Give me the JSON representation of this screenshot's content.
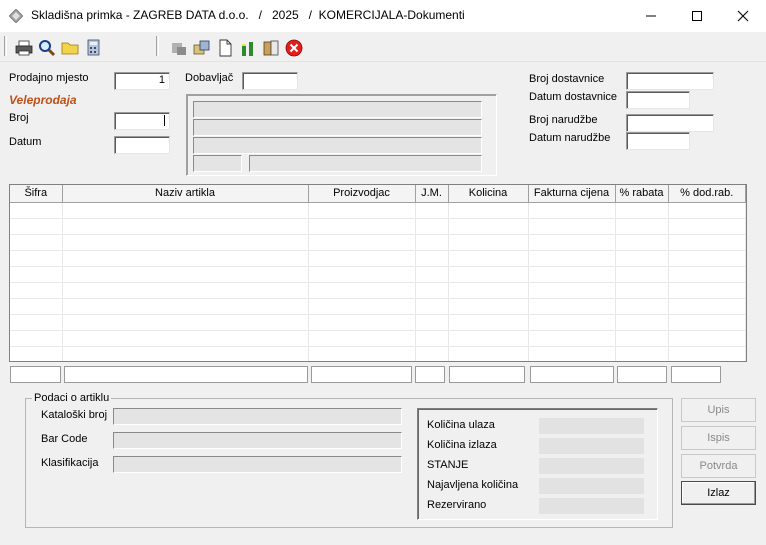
{
  "window": {
    "title": "Skladišna primka - ZAGREB DATA d.o.o.   /   2025   /  KOMERCIJALA-Dokumenti"
  },
  "toolbar": {
    "icons": [
      "printer-icon",
      "search-icon",
      "folder-icon",
      "calculator-icon",
      "copy-disabled-icon",
      "transfer-icon",
      "new-document-icon",
      "chart-icon",
      "book-icon",
      "close-red-icon"
    ]
  },
  "header": {
    "prodajno_mjesto_label": "Prodajno mjesto",
    "prodajno_mjesto_value": "1",
    "veleprodaja": "Veleprodaja",
    "broj_label": "Broj",
    "broj_value": "",
    "datum_label": "Datum",
    "datum_value": "",
    "dobavljac_label": "Dobavljač",
    "dobavljac_value": "",
    "broj_dostavnice_label": "Broj dostavnice",
    "broj_dostavnice_value": "",
    "datum_dostavnice_label": "Datum dostavnice",
    "datum_dostavnice_value": "",
    "broj_narudzbe_label": "Broj narudžbe",
    "broj_narudzbe_value": "",
    "datum_narudzbe_label": "Datum narudžbe",
    "datum_narudzbe_value": ""
  },
  "grid": {
    "columns": [
      "Šifra",
      "Naziv artikla",
      "Proizvodjac",
      "J.M.",
      "Kolicina",
      "Fakturna cijena",
      "% rabata",
      "% dod.rab."
    ],
    "rows": []
  },
  "artikl": {
    "group_title": "Podaci o artiklu",
    "kataloski_broj_label": "Kataloški broj",
    "bar_code_label": "Bar Code",
    "klasifikacija_label": "Klasifikacija",
    "kolicina_ulaza_label": "Količina ulaza",
    "kolicina_izlaza_label": "Količina izlaza",
    "stanje_label": "STANJE",
    "najavljena_kolicina_label": "Najavljena količina",
    "rezervirano_label": "Rezervirano"
  },
  "buttons": {
    "upis": "Upis",
    "ispis": "Ispis",
    "potvrda": "Potvrda",
    "izlaz": "Izlaz"
  },
  "colors": {
    "accent_veleprodaja": "#c05018",
    "close_icon_red": "#e0201e"
  }
}
